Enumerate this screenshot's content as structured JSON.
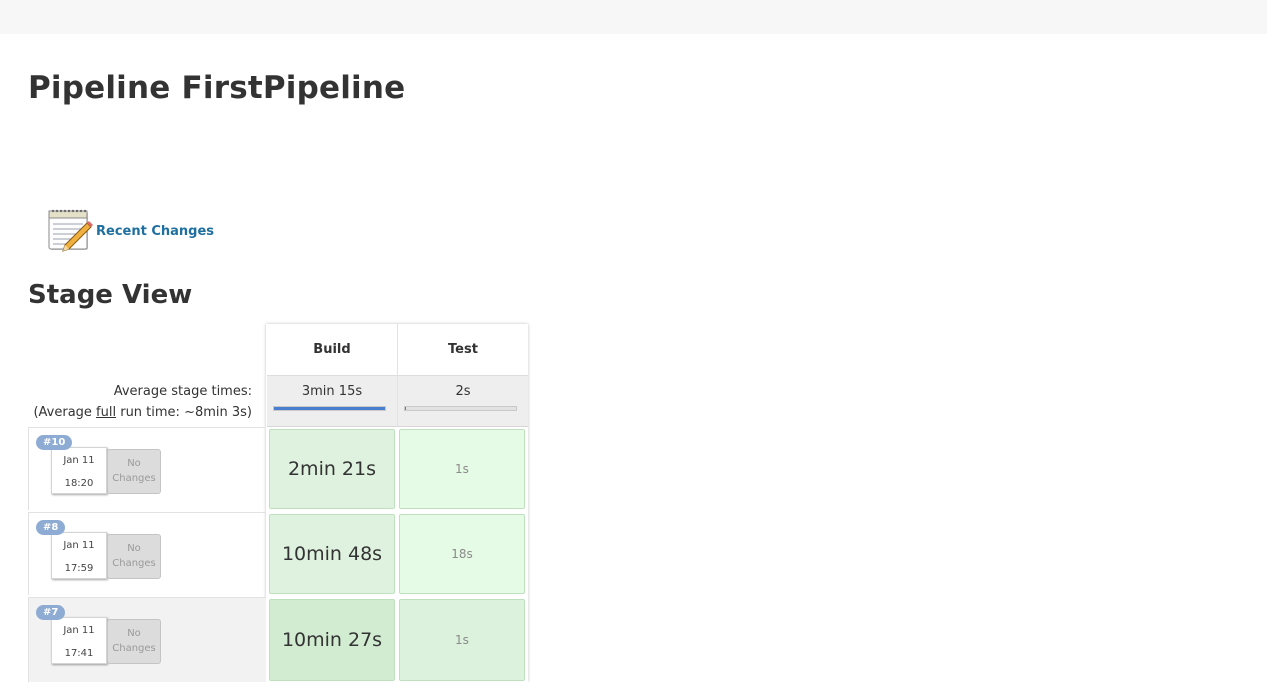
{
  "page": {
    "title": "Pipeline FirstPipeline"
  },
  "links": {
    "recent_changes": "Recent Changes"
  },
  "stage_view": {
    "title": "Stage View",
    "avg_stage_times_label": "Average stage times:",
    "avg_full_prefix": "(Average ",
    "avg_full_word": "full",
    "avg_full_suffix": " run time: ~8min 3s)",
    "stages": [
      {
        "name": "Build",
        "avg_time": "3min 15s",
        "avg_progress": 1.0
      },
      {
        "name": "Test",
        "avg_time": "2s",
        "avg_progress": 0.01
      }
    ],
    "builds": [
      {
        "badge": "#10",
        "date": "Jan 11",
        "time": "18:20",
        "changes": "No Changes",
        "durations": [
          "2min 21s",
          "1s"
        ]
      },
      {
        "badge": "#8",
        "date": "Jan 11",
        "time": "17:59",
        "changes": "No Changes",
        "durations": [
          "10min 48s",
          "18s"
        ]
      },
      {
        "badge": "#7",
        "date": "Jan 11",
        "time": "17:41",
        "changes": "No Changes",
        "durations": [
          "10min 27s",
          "1s"
        ]
      }
    ],
    "colors": {
      "success_cell": "#dff2df",
      "success_cell_light": "#e6fbe6",
      "success_cell_hover": "#d2ecd2",
      "avg_bar": "#4a7fd0",
      "badge": "#8eacd3"
    }
  }
}
